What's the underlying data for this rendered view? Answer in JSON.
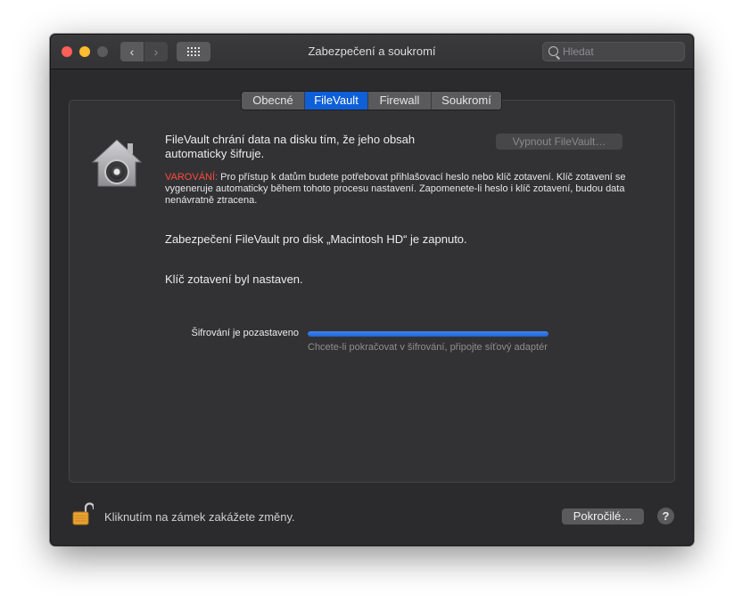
{
  "window": {
    "title": "Zabezpečení a soukromí"
  },
  "search": {
    "placeholder": "Hledat"
  },
  "tabs": [
    {
      "label": "Obecné"
    },
    {
      "label": "FileVault"
    },
    {
      "label": "Firewall"
    },
    {
      "label": "Soukromí"
    }
  ],
  "active_tab": "FileVault",
  "filevault": {
    "intro": "FileVault chrání data na disku tím, že jeho obsah automaticky šifruje.",
    "turn_off_label": "Vypnout FileVault…",
    "warning_label": "VAROVÁNÍ:",
    "warning_text": " Pro přístup k datům budete potřebovat přihlašovací heslo nebo klíč zotavení. Klíč zotavení se vygeneruje automaticky během tohoto procesu nastavení. Zapomenete-li heslo i klíč zotavení, budou data nenávratně ztracena.",
    "status_on": "Zabezpečení FileVault pro disk „Macintosh HD“ je zapnuto.",
    "status_key": "Klíč zotavení byl nastaven.",
    "progress_label": "Šifrování je pozastaveno",
    "progress_hint": "Chcete-li pokračovat v šifrování, připojte síťový adaptér",
    "progress_fraction": 1.0
  },
  "footer": {
    "lock_text": "Kliknutím na zámek zakážete změny.",
    "advanced_label": "Pokročilé…",
    "help_label": "?"
  },
  "colors": {
    "accent": "#0e5fd8",
    "warning": "#ff4a3d",
    "progress": "#2f75e8"
  }
}
